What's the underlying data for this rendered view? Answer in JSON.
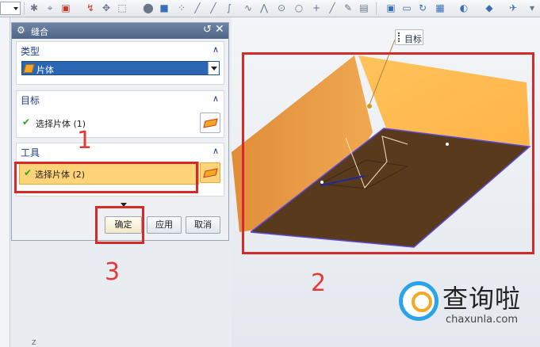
{
  "dialog": {
    "title": "缝合",
    "groups": {
      "type": {
        "label": "类型",
        "selected": "片体"
      },
      "target": {
        "label": "目标",
        "selection": "选择片体 (1)"
      },
      "tool": {
        "label": "工具",
        "selection": "选择片体 (2)"
      }
    },
    "buttons": {
      "ok": "确定",
      "apply": "应用",
      "cancel": "取消"
    }
  },
  "viewport": {
    "target_label": "目标"
  },
  "annotations": {
    "n1": "1",
    "n2": "2",
    "n3": "3"
  },
  "watermark": {
    "cn": "查询啦",
    "en": "chaxunla.com"
  },
  "colors": {
    "accent": "#2b66b3",
    "highlight": "#ffd479",
    "annotation": "#d42a2a",
    "sheet_top": "#ffb84d",
    "sheet_bottom": "#5a3a1d"
  }
}
